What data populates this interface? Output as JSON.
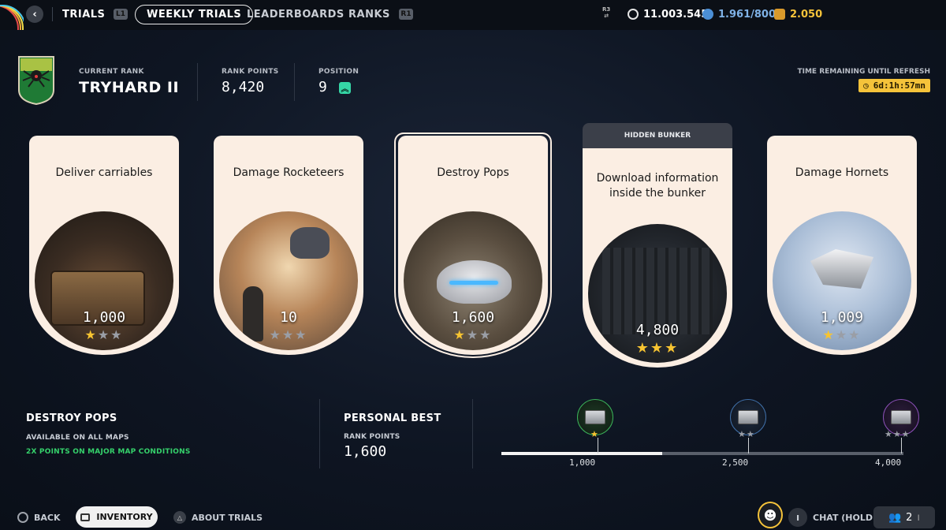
{
  "topbar": {
    "trials_label": "TRIALS",
    "l1": "L1",
    "weekly_trials_label": "WEEKLY TRIALS",
    "leaderboards_label": "LEADERBOARDS",
    "ranks_label": "RANKS",
    "r1": "R1",
    "r3": "R3",
    "currency_a": "11.003.545",
    "currency_b": "1.961/800",
    "currency_c": "2.050"
  },
  "rank": {
    "current_rank_label": "CURRENT RANK",
    "current_rank": "TRYHARD II",
    "rank_points_label": "RANK POINTS",
    "rank_points": "8,420",
    "position_label": "POSITION",
    "position": "9",
    "refresh_label": "TIME REMAINING UNTIL REFRESH",
    "refresh_time": "6d:1h:57mn"
  },
  "cards": [
    {
      "title": "Deliver carriables",
      "score": "1,000",
      "stars": 1
    },
    {
      "title": "Damage Rocketeers",
      "score": "10",
      "stars": 0
    },
    {
      "title": "Destroy Pops",
      "score": "1,600",
      "stars": 1
    },
    {
      "banner": "HIDDEN BUNKER",
      "title": "Download information inside the bunker",
      "score": "4,800",
      "stars": 3
    },
    {
      "title": "Damage Hornets",
      "score": "1,009",
      "stars": 1
    }
  ],
  "details": {
    "title": "DESTROY POPS",
    "availability": "AVAILABLE ON ALL MAPS",
    "bonus": "2X POINTS ON MAJOR MAP CONDITIONS",
    "personal_best_label": "PERSONAL BEST",
    "rank_points_label": "RANK POINTS",
    "personal_best": "1,600"
  },
  "progress": {
    "current": 1600,
    "max": 4000,
    "milestones": [
      {
        "value": "1,000",
        "stars": 1,
        "reached": true
      },
      {
        "value": "2,500",
        "stars": 2,
        "reached": false
      },
      {
        "value": "4,000",
        "stars": 3,
        "reached": false
      }
    ]
  },
  "footer": {
    "back": "BACK",
    "inventory": "INVENTORY",
    "about": "ABOUT TRIALS",
    "chat": "CHAT (HOLD)",
    "party_count": "2"
  },
  "colors": {
    "card_bg": "#fbeee3",
    "star_on": "#f7c431",
    "timer_bg": "#f5c33a",
    "accent_green": "#35d16b",
    "position_up": "#35d6a6"
  }
}
